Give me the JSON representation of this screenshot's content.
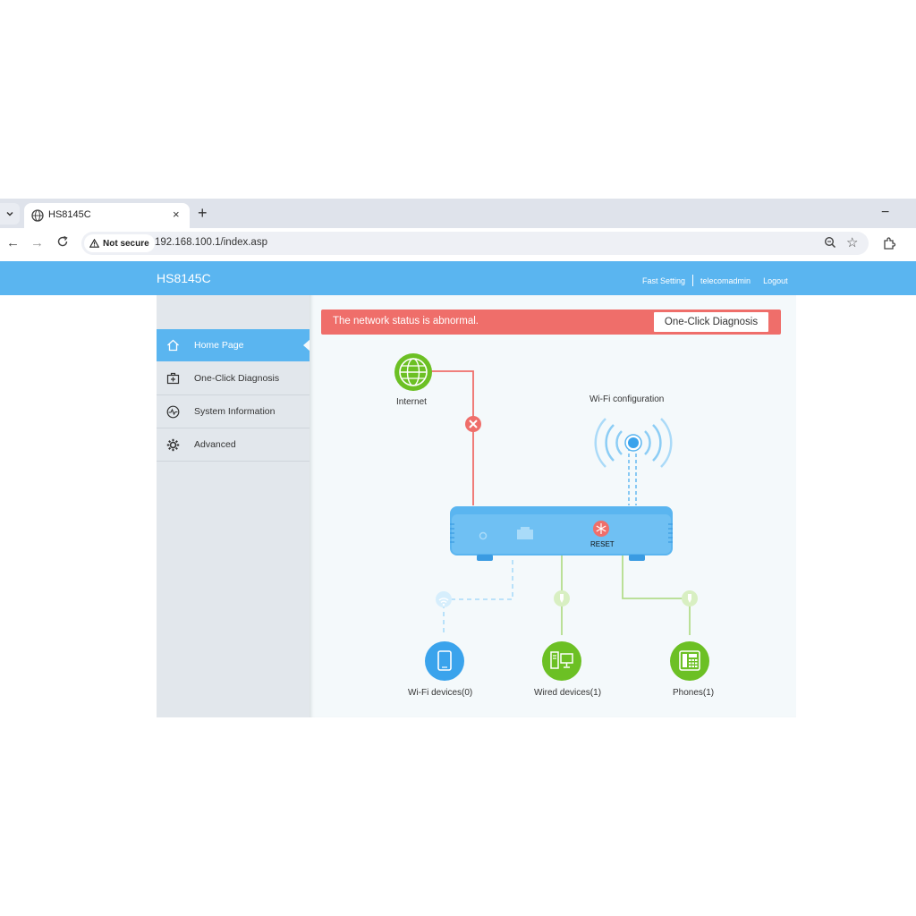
{
  "browser": {
    "tab_title": "HS8145C",
    "tab_close": "×",
    "new_tab": "+",
    "minimize": "−",
    "security_chip": "Not secure",
    "url": "192.168.100.1/index.asp"
  },
  "header": {
    "brand": "HS8145C",
    "fast_setting": "Fast Setting",
    "user": "telecomadmin",
    "logout": "Logout"
  },
  "sidebar": {
    "items": [
      {
        "label": "Home Page",
        "icon": "home-icon"
      },
      {
        "label": "One-Click Diagnosis",
        "icon": "medkit-icon"
      },
      {
        "label": "System Information",
        "icon": "pulse-icon"
      },
      {
        "label": "Advanced",
        "icon": "gear-icon"
      }
    ],
    "active_index": 0
  },
  "alert": {
    "message": "The network status is abnormal.",
    "button": "One-Click Diagnosis"
  },
  "topology": {
    "internet_label": "Internet",
    "wifi_config_label": "Wi-Fi configuration",
    "reset_label": "RESET",
    "wifi_devices_label": "Wi-Fi devices(0)",
    "wired_devices_label": "Wired devices(1)",
    "phones_label": "Phones(1)"
  },
  "colors": {
    "header_blue": "#5ab5f0",
    "alert_red": "#ef6e6a",
    "device_green": "#6cc024",
    "wifi_blue": "#3aa3ec",
    "error_red": "#ef6e6a"
  }
}
